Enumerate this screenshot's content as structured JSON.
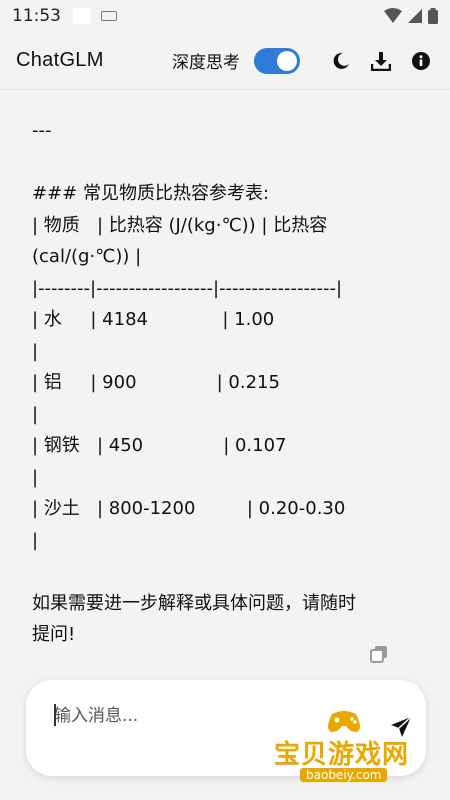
{
  "status_bar": {
    "time": "11:53"
  },
  "app_bar": {
    "title": "ChatGLM",
    "deep_think_label": "深度思考",
    "deep_think_enabled": true,
    "icons": [
      "moon-icon",
      "download-icon",
      "info-icon"
    ]
  },
  "message": {
    "lines": [
      "---",
      "",
      "### 常见物质比热容参考表:",
      "| 物质   | 比热容 (J/(kg·℃)) | 比热容",
      "(cal/(g·℃)) |",
      "|--------|------------------|------------------|",
      "| 水     | 4184             | 1.00",
      "|",
      "| 铝     | 900              | 0.215",
      "|",
      "| 钢铁   | 450              | 0.107",
      "|",
      "| 沙土   | 800-1200         | 0.20-0.30",
      "|",
      "",
      "如果需要进一步解释或具体问题，请随时",
      "提问!"
    ]
  },
  "input": {
    "placeholder": "输入消息..."
  },
  "watermark": {
    "title": "宝贝游戏网",
    "url": "baobeiy.com"
  },
  "colors": {
    "accent": "#2f7bd8",
    "background": "#f3f3f3",
    "watermark": "#e8a800"
  }
}
